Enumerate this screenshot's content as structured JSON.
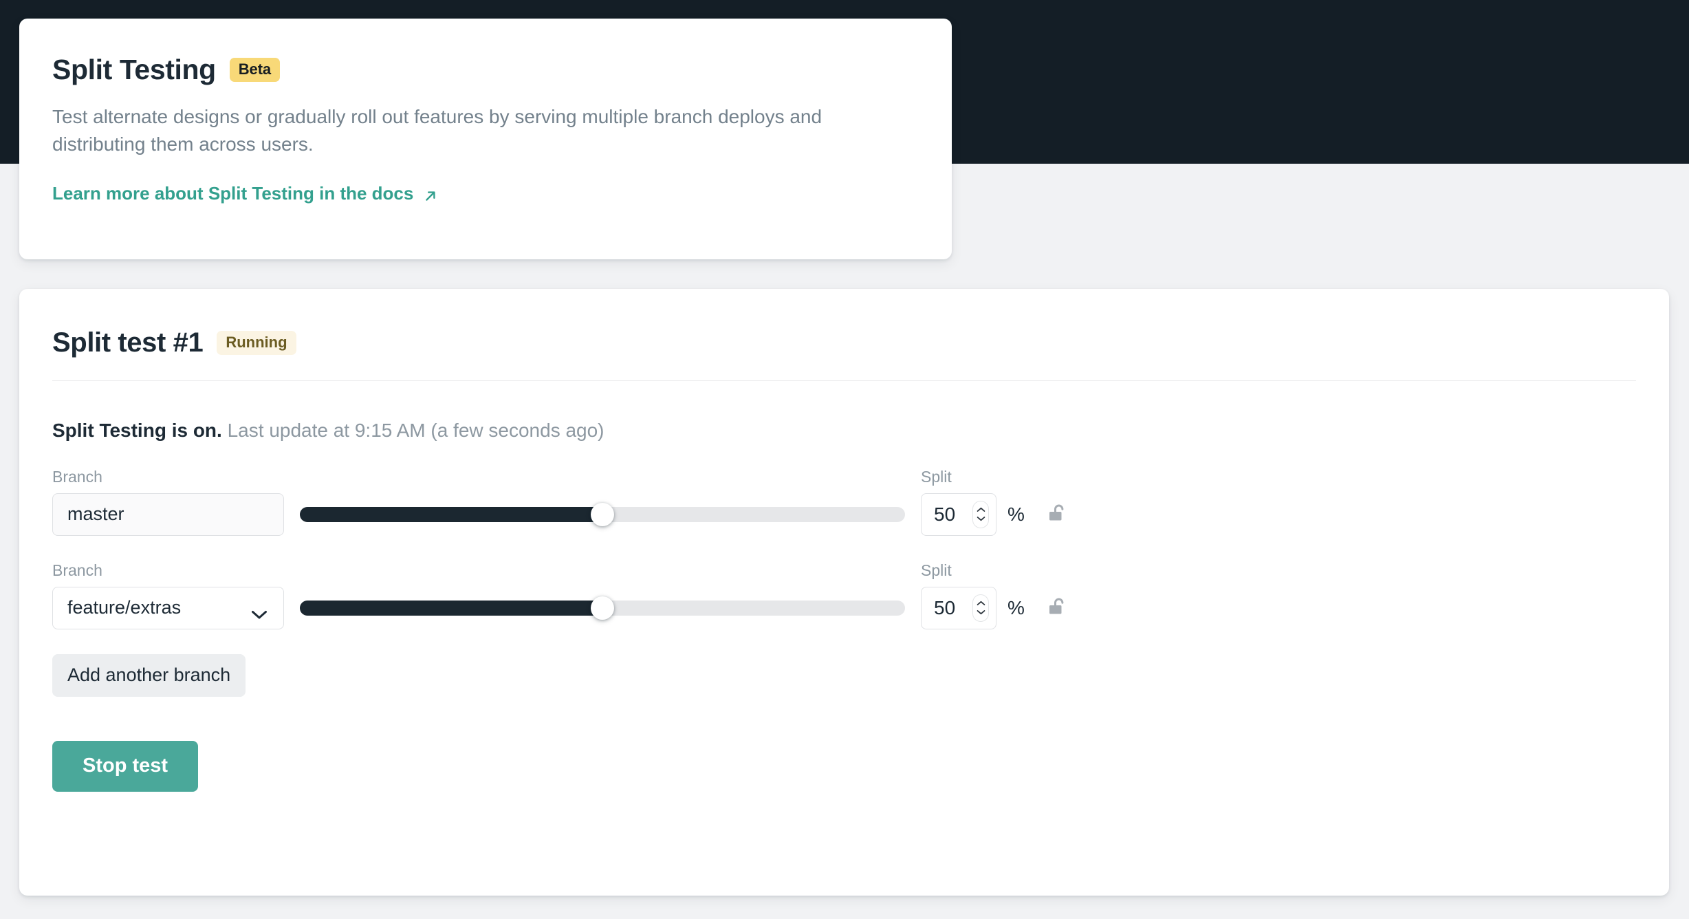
{
  "theme": {
    "header_band_color": "#141e26",
    "page_background": "#f1f2f4",
    "card_background": "#ffffff",
    "accent_teal": "#4aa89a",
    "link_teal": "#33a08e",
    "beta_badge_bg": "#f8d978",
    "running_badge_bg": "#fbf4e3",
    "running_badge_text": "#6b5c22",
    "slider_fill": "#1b2730",
    "slider_track": "#e6e7e9"
  },
  "info_card": {
    "title": "Split Testing",
    "badge": "Beta",
    "description": "Test alternate designs or gradually roll out features by serving multiple branch deploys and distributing them across users.",
    "link_label": "Learn more about Split Testing in the docs",
    "link_icon": "arrow-up-right-icon"
  },
  "test_card": {
    "title": "Split test #1",
    "status_badge": "Running",
    "status_strong": "Split Testing is on.",
    "status_detail": "Last update at 9:15 AM (a few seconds ago)",
    "branch_label": "Branch",
    "split_label": "Split",
    "percent_symbol": "%",
    "rows": [
      {
        "branch_label": "Branch",
        "branch_value": "master",
        "branch_is_select": false,
        "split_label": "Split",
        "split_value": "50",
        "slider_percent": 50,
        "lock_state": "unlocked",
        "lock_icon": "lock-open-icon"
      },
      {
        "branch_label": "Branch",
        "branch_value": "feature/extras",
        "branch_is_select": true,
        "split_label": "Split",
        "split_value": "50",
        "slider_percent": 50,
        "lock_state": "unlocked",
        "lock_icon": "lock-open-icon"
      }
    ],
    "add_branch_label": "Add another branch",
    "stop_test_label": "Stop test"
  }
}
